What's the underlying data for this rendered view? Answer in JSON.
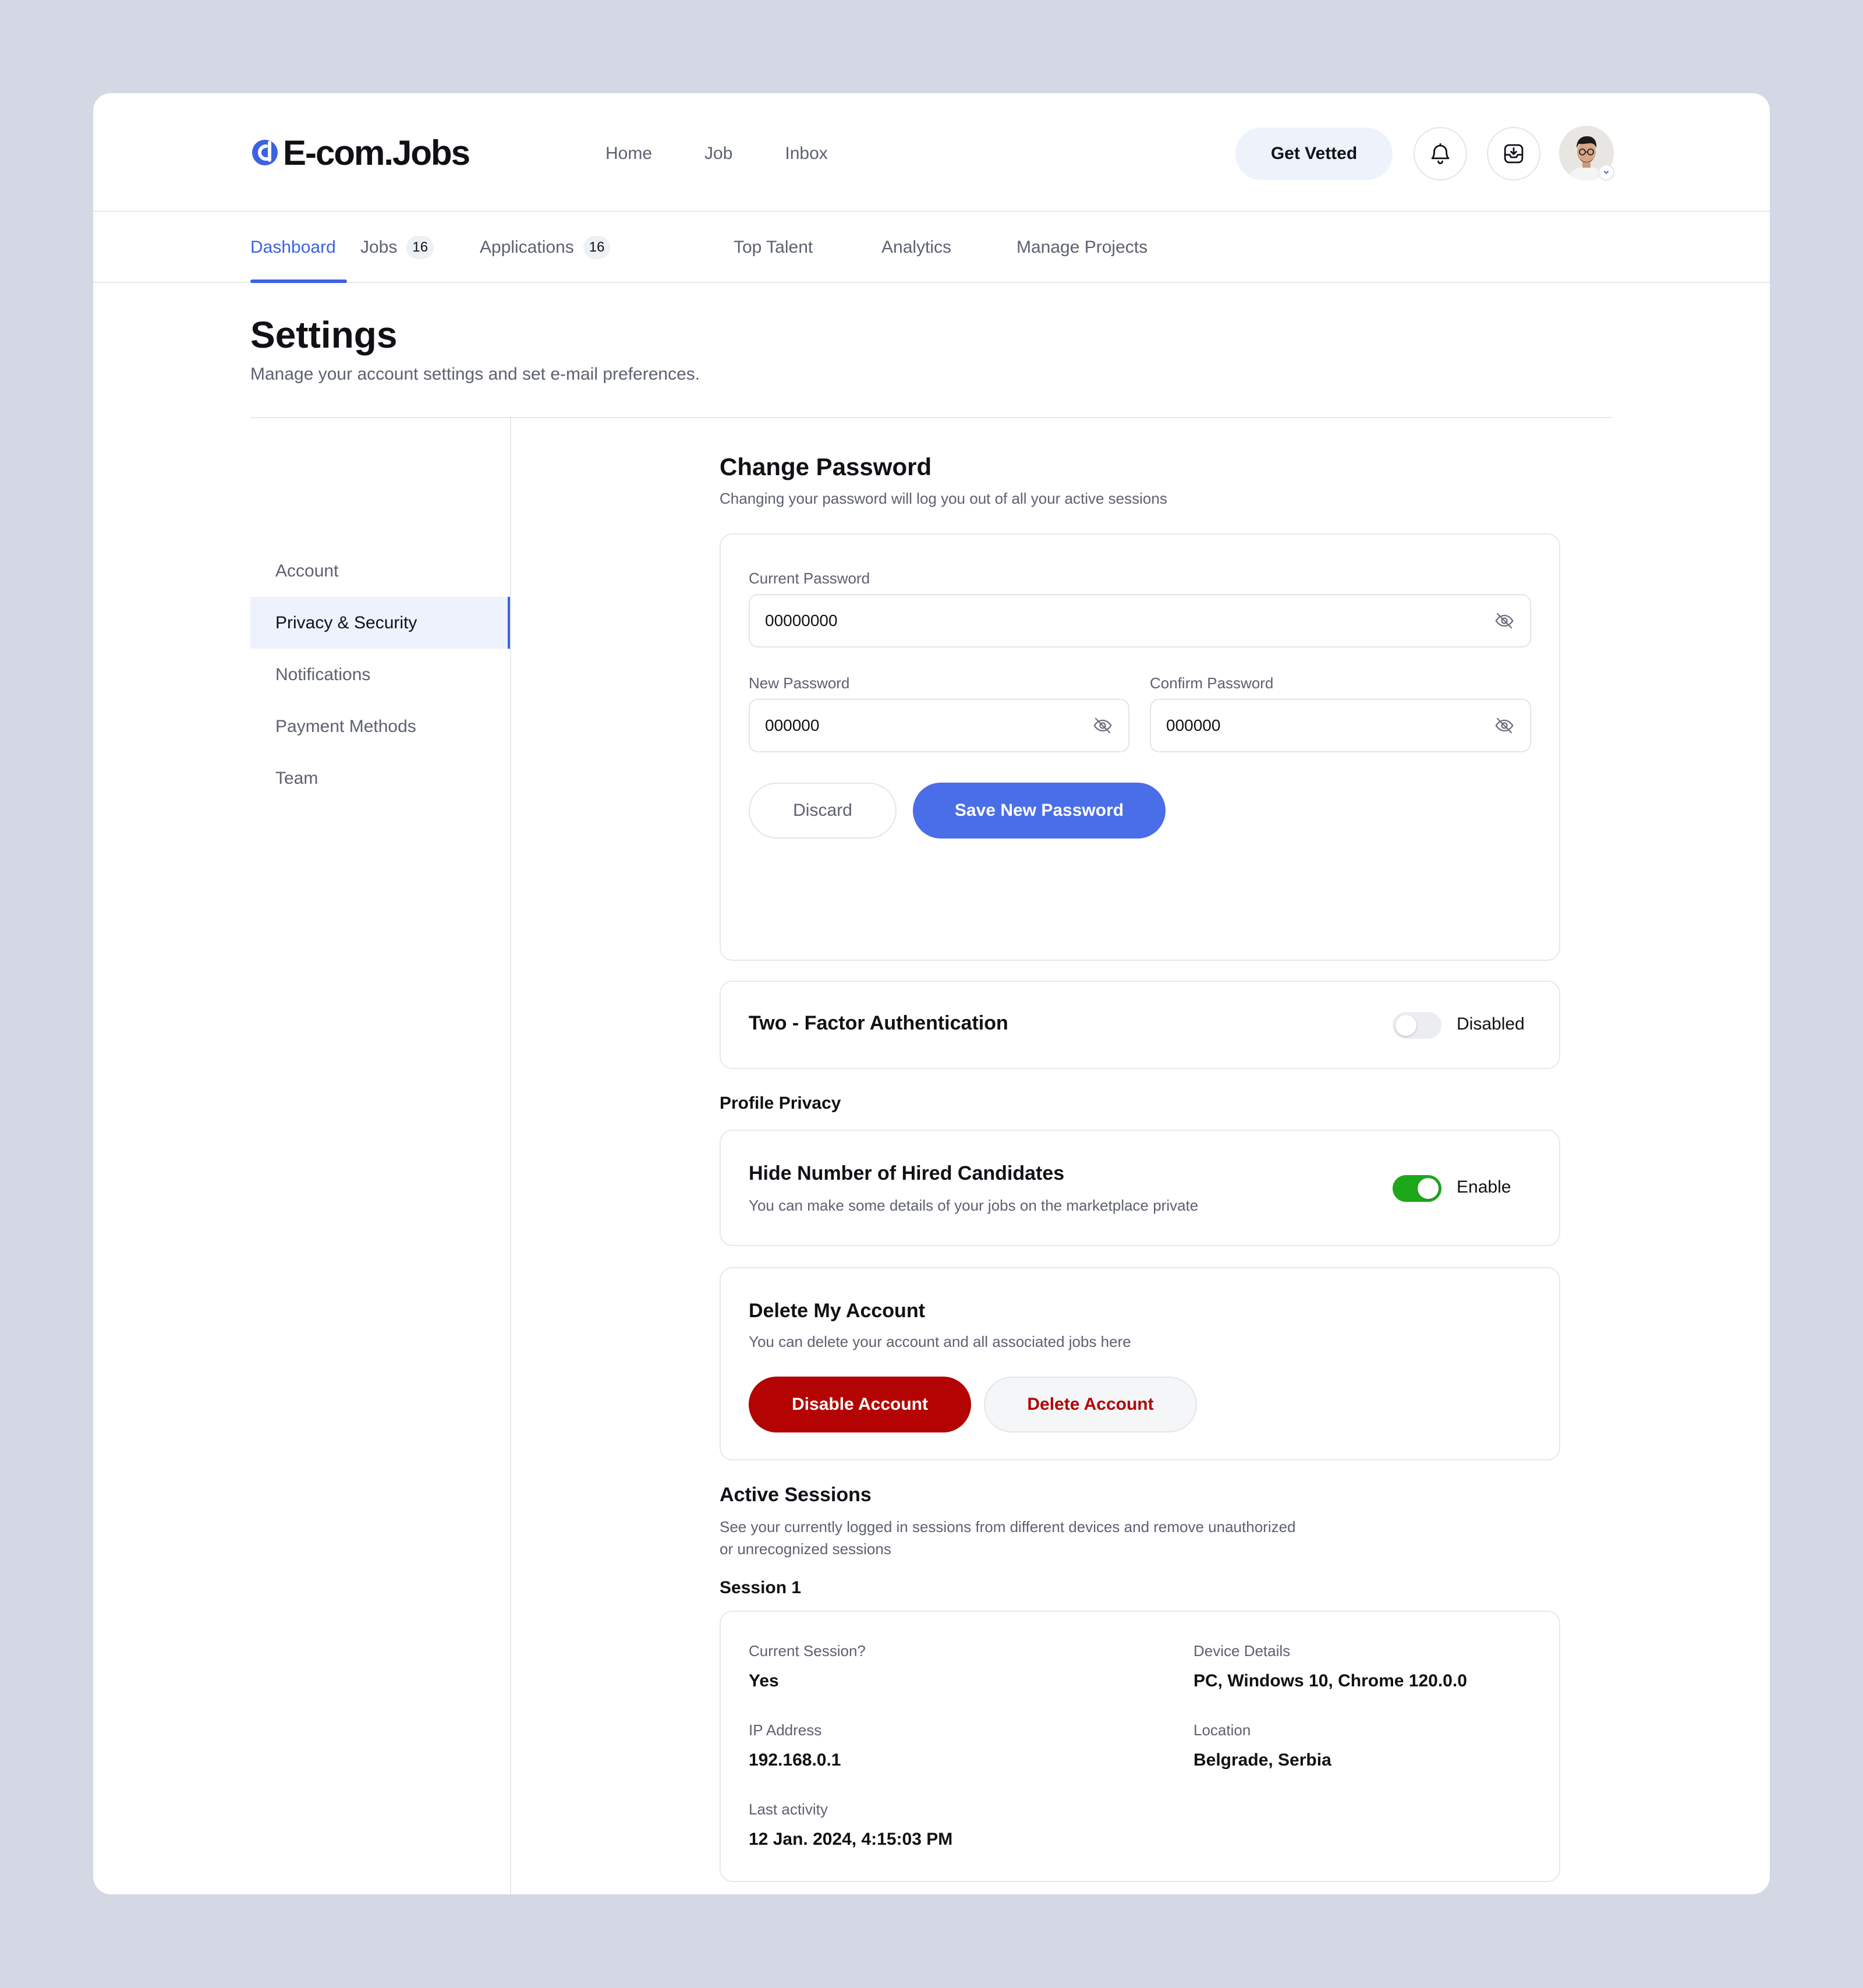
{
  "brand": {
    "name": "E-com.Jobs",
    "accent": "#3b62e0"
  },
  "topnav": {
    "items": [
      "Home",
      "Job",
      "Inbox"
    ]
  },
  "header": {
    "get_vetted_label": "Get Vetted",
    "icons": [
      "bell-icon",
      "inbox-download-icon",
      "user-avatar"
    ]
  },
  "tabs": [
    {
      "label": "Dashboard",
      "active": true
    },
    {
      "label": "Jobs",
      "badge": "16"
    },
    {
      "label": "Applications",
      "badge": "16"
    },
    {
      "label": "Top Talent"
    },
    {
      "label": "Analytics"
    },
    {
      "label": "Manage Projects"
    }
  ],
  "page": {
    "title": "Settings",
    "subtitle": "Manage your account settings and set e-mail preferences."
  },
  "sidebar": {
    "items": [
      {
        "label": "Account"
      },
      {
        "label": "Privacy & Security",
        "active": true
      },
      {
        "label": "Notifications"
      },
      {
        "label": "Payment Methods"
      },
      {
        "label": "Team"
      }
    ]
  },
  "change_password": {
    "title": "Change Password",
    "subtitle": "Changing your password will log you out of all your active sessions",
    "current_label": "Current Password",
    "current_value": "00000000",
    "new_label": "New Password",
    "new_value": "000000",
    "confirm_label": "Confirm Password",
    "confirm_value": "000000",
    "discard_label": "Discard",
    "save_label": "Save New Password"
  },
  "two_factor": {
    "title": "Two - Factor Authentication",
    "enabled": false,
    "status_label": "Disabled"
  },
  "profile_privacy": {
    "heading": "Profile Privacy",
    "title": "Hide Number of Hired Candidates",
    "subtitle": "You can make some details of your jobs on the marketplace private",
    "enabled": true,
    "status_label": "Enable"
  },
  "delete_account": {
    "title": "Delete My Account",
    "subtitle": "You can delete your account and all associated jobs here",
    "disable_label": "Disable Account",
    "delete_label": "Delete Account",
    "danger_color": "#b40303"
  },
  "active_sessions": {
    "title": "Active Sessions",
    "subtitle_line1": "See your currently logged in sessions from different devices and remove unauthorized",
    "subtitle_line2": "or unrecognized sessions",
    "session_heading": "Session 1",
    "current_session_label": "Current Session?",
    "current_session_value": "Yes",
    "device_label": "Device Details",
    "device_value": "PC, Windows 10, Chrome 120.0.0",
    "ip_label": "IP Address",
    "ip_value": "192.168.0.1",
    "location_label": "Location",
    "location_value": "Belgrade, Serbia",
    "last_activity_label": "Last activity",
    "last_activity_value": "12 Jan. 2024, 4:15:03 PM"
  }
}
